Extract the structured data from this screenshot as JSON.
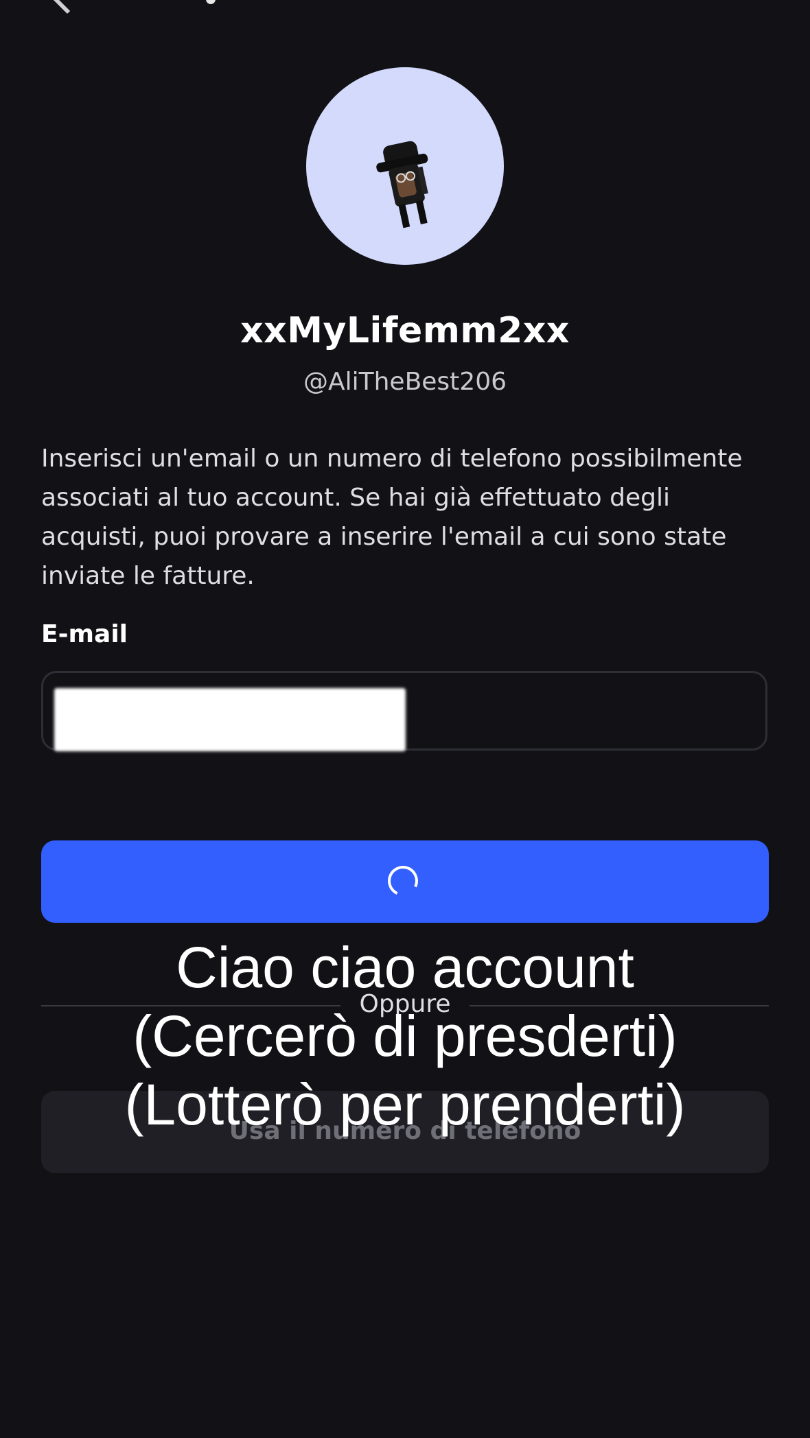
{
  "header": {
    "back_icon": "chevron-left-icon"
  },
  "profile": {
    "avatar_icon": "avatar-character-icon",
    "avatar_bg": "#d3dafb",
    "display_name": "xxMyLifemm2xx",
    "username": "@AliTheBest206"
  },
  "instructions": {
    "text": "Inserisci un'email o un numero di telefono possibilmente associati al tuo account. Se hai già effettuato degli acquisti, puoi provare a inserire l'email a cui sono state inviate le fatture."
  },
  "email_field": {
    "label": "E-mail",
    "value": ""
  },
  "submit_button": {
    "state": "loading",
    "icon": "loading-spinner-icon",
    "color": "#335fff"
  },
  "divider": {
    "label": "Oppure"
  },
  "phone_button": {
    "label": "Usa il numero di telefono"
  },
  "caption_overlay": {
    "line1": "Ciao ciao account",
    "line2": "(Cercerò di presderti)",
    "line3": "(Lotterò per prenderti)"
  },
  "colors": {
    "background": "#111116",
    "accent": "#335fff"
  }
}
